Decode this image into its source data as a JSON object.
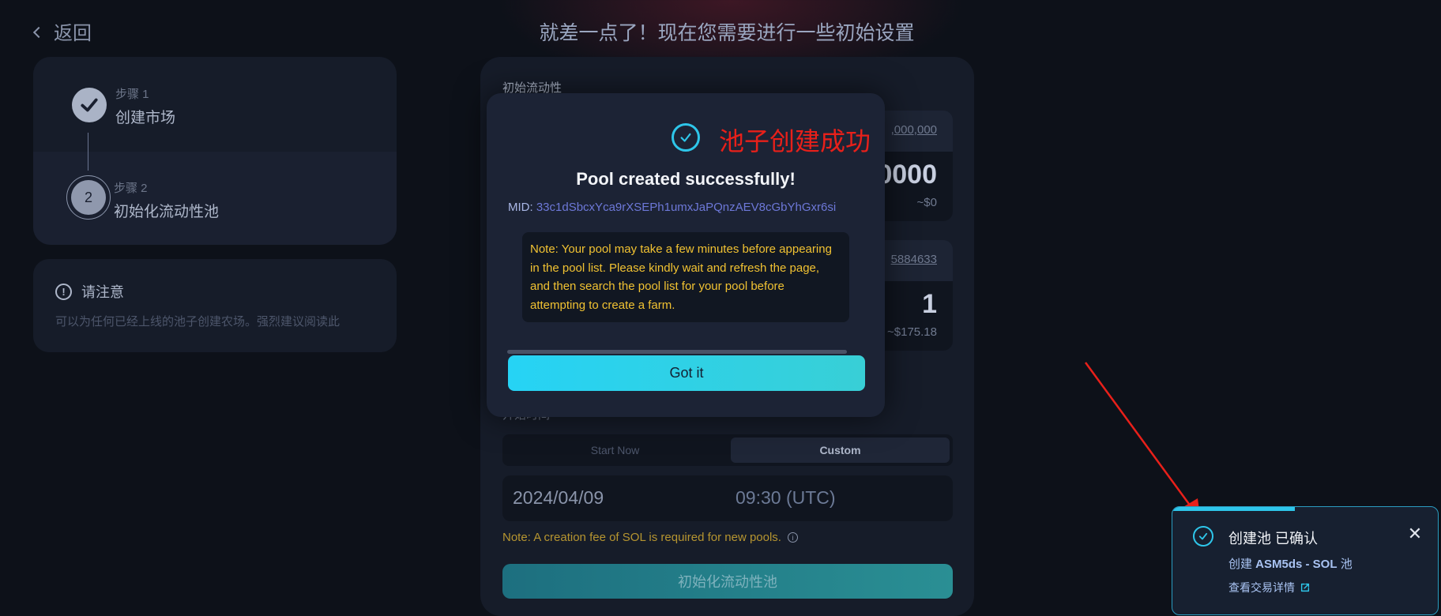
{
  "nav": {
    "back_label": "返回"
  },
  "header": {
    "title": "就差一点了！现在您需要进行一些初始设置"
  },
  "steps": [
    {
      "small": "步骤 1",
      "label": "创建市场"
    },
    {
      "small": "步骤 2",
      "label": "初始化流动性池",
      "number": "2"
    }
  ],
  "notice": {
    "title": "请注意",
    "body": "可以为任何已经上线的池子创建农场。强烈建议阅读此"
  },
  "form": {
    "section_label": "初始流动性",
    "base": {
      "balance": ",000,000",
      "amount": "0000",
      "usd": "~$0"
    },
    "quote": {
      "balance": "5884633",
      "amount": "1",
      "usd": "~$175.18"
    },
    "start_label": "开始时间",
    "segment": {
      "start_now": "Start Now",
      "custom": "Custom"
    },
    "date": "2024/04/09",
    "time": "09:30 (UTC)",
    "fee_note": "Note: A creation fee of  SOL is required for new pools.",
    "submit_label": "初始化流动性池"
  },
  "modal": {
    "annotation": "池子创建成功",
    "title": "Pool created successfully!",
    "mid_label": "MID:",
    "mid_value": "33c1dSbcxYca9rXSEPh1umxJaPQnzAEV8cGbYhGxr6si",
    "note": "Note: Your pool may take a few minutes before appearing in the pool list. Please kindly wait and refresh the page, and then search the pool list for your pool before attempting to create a farm.",
    "button_label": "Got it"
  },
  "toast": {
    "title": "创建池 已确认",
    "sub_prefix": "创建 ",
    "sub_pair": "ASM5ds - SOL",
    "sub_suffix": " 池",
    "link": "查看交易详情",
    "progress": 0.46
  },
  "colors": {
    "accent": "#2ec6ea",
    "annotation_red": "#e8201a",
    "warning": "#f1c232",
    "background": "#0d1119",
    "panel": "#161c29"
  },
  "icons": [
    "chevron-left-icon",
    "check-icon",
    "info-circle-icon",
    "close-icon",
    "external-link-icon"
  ]
}
